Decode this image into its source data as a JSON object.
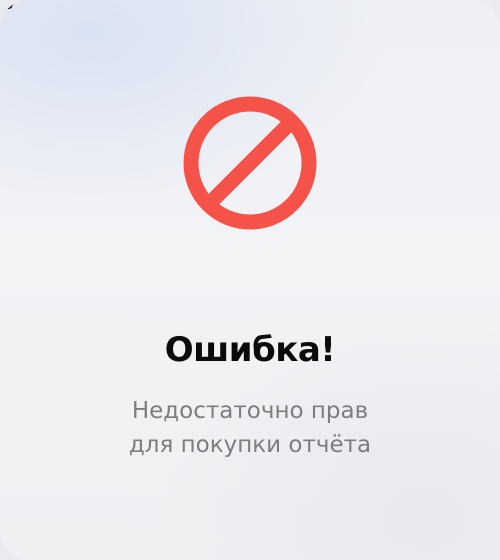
{
  "corner_text": "ю",
  "dialog": {
    "icon": "prohibited-icon",
    "icon_color": "#f5534a",
    "title": "Ошибка!",
    "message_line1": "Недостаточно прав",
    "message_line2": "для покупки отчёта"
  }
}
